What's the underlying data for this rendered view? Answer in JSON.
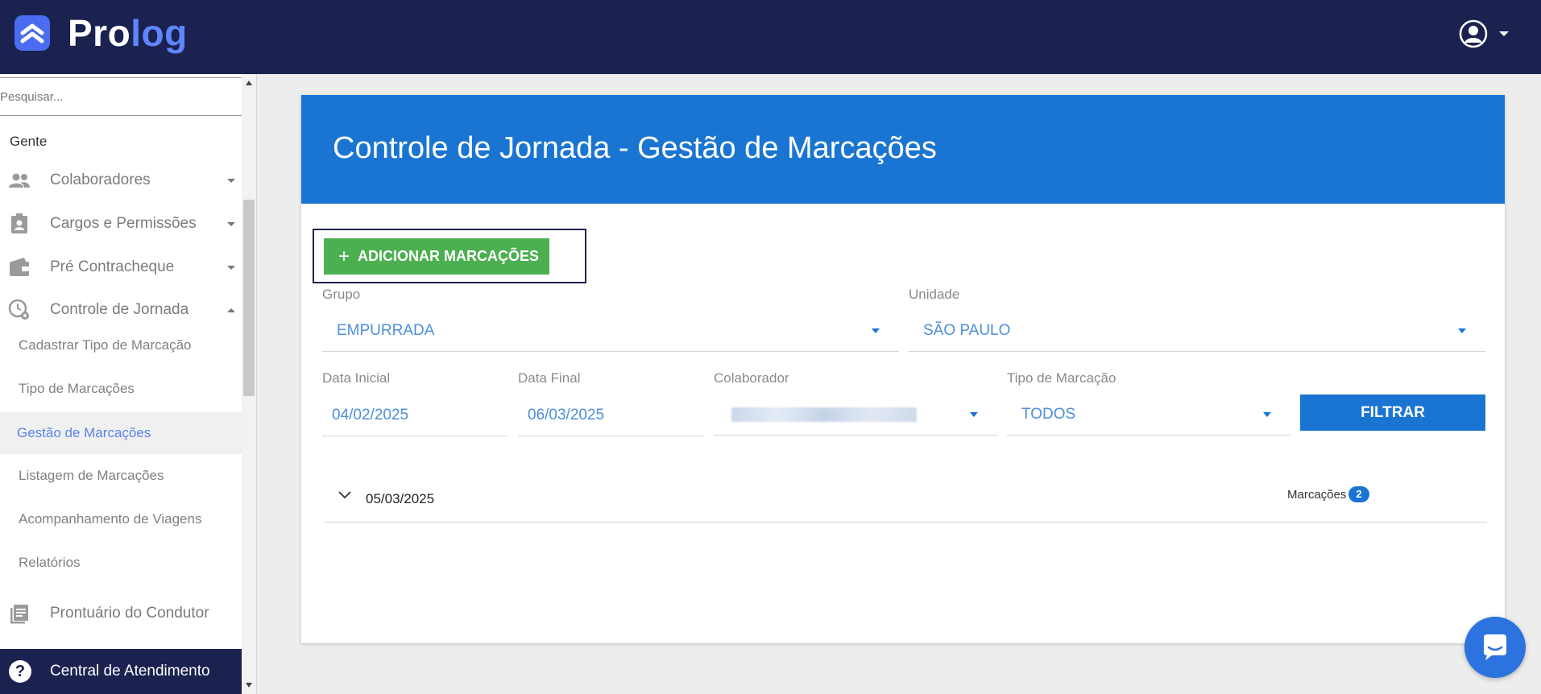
{
  "brand": {
    "name_part1": "Pro",
    "name_part2": "log"
  },
  "header": {
    "user_icon": "account-circle-icon"
  },
  "sidebar": {
    "search_placeholder": "Pesquisar...",
    "section": "Gente",
    "items": [
      {
        "label": "Colaboradores",
        "icon": "people-icon"
      },
      {
        "label": "Cargos e Permissões",
        "icon": "badge-icon"
      },
      {
        "label": "Pré Contracheque",
        "icon": "wallet-icon"
      },
      {
        "label": "Controle de Jornada",
        "icon": "clock-settings-icon"
      }
    ],
    "sub_items": [
      "Cadastrar Tipo de Marcação",
      "Tipo de Marcações",
      "Gestão de Marcações",
      "Listagem de Marcações",
      "Acompanhamento de Viagens",
      "Relatórios"
    ],
    "bottom_item": {
      "label": "Prontuário do Condutor",
      "icon": "book-icon"
    },
    "help": {
      "label": "Central de Atendimento",
      "glyph": "?"
    }
  },
  "page": {
    "title": "Controle de Jornada - Gestão de Marcações",
    "add_button": "ADICIONAR MARCAÇÕES",
    "add_glyph": "+",
    "filters": {
      "grupo_label": "Grupo",
      "grupo_value": "EMPURRADA",
      "unidade_label": "Unidade",
      "unidade_value": "SÃO PAULO",
      "data_inicial_label": "Data Inicial",
      "data_inicial_value": "04/02/2025",
      "data_final_label": "Data Final",
      "data_final_value": "06/03/2025",
      "colaborador_label": "Colaborador",
      "tipo_label": "Tipo de Marcação",
      "tipo_value": "TODOS",
      "filter_button": "FILTRAR"
    },
    "groups": [
      {
        "date": "05/03/2025",
        "count_label": "Marcações",
        "count": "2"
      }
    ]
  },
  "colors": {
    "header_bg": "#1b2250",
    "accent_blue": "#1a75d2",
    "add_green": "#4caf50"
  }
}
